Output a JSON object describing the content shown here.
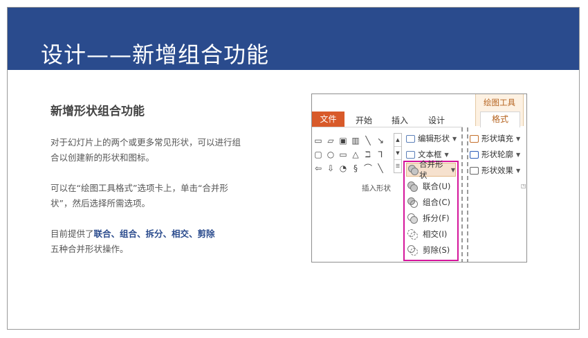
{
  "slide": {
    "title": "设计——新增组合功能",
    "heading": "新增形状组合功能",
    "para1": "对于幻灯片上的两个或更多常见形状，可以进行组合以创建新的形状和图标。",
    "para2": "可以在“绘图工具格式”选项卡上，单击“合并形状”，然后选择所需选项。",
    "para3_prefix": "目前提供了",
    "para3_ops": "联合、组合、拆分、相交、剪除",
    "para3_suffix": "五种合并形状操作。"
  },
  "ribbon": {
    "tabs": {
      "file": "文件",
      "start": "开始",
      "insert": "插入",
      "design": "设计"
    },
    "drawing_tools": "绘图工具",
    "format_tab": "格式",
    "insert_shapes_caption": "插入形状",
    "edit_shape": "编辑形状",
    "textbox": "文本框",
    "merge_shapes": "合并形状",
    "shape_fill": "形状填充",
    "shape_outline": "形状轮廓",
    "shape_effects": "形状效果",
    "merge_menu": [
      {
        "label": "联合(U)",
        "icon": "union-icon"
      },
      {
        "label": "组合(C)",
        "icon": "combine-icon"
      },
      {
        "label": "拆分(F)",
        "icon": "fragment-icon"
      },
      {
        "label": "相交(I)",
        "icon": "intersect-icon"
      },
      {
        "label": "剪除(S)",
        "icon": "subtract-icon"
      }
    ]
  },
  "colors": {
    "banner": "#2a4b8d",
    "file_tab": "#d85a2a",
    "highlight_border": "#d4149a"
  },
  "shape_glyphs": [
    [
      "▭",
      "▱",
      "▣",
      "▥",
      "╲",
      "↘"
    ],
    [
      "▢",
      "○",
      "▭",
      "△",
      "ℶ",
      "⅂"
    ],
    [
      "⇦",
      "⇩",
      "◔",
      "§",
      "⌒",
      "╲"
    ]
  ]
}
